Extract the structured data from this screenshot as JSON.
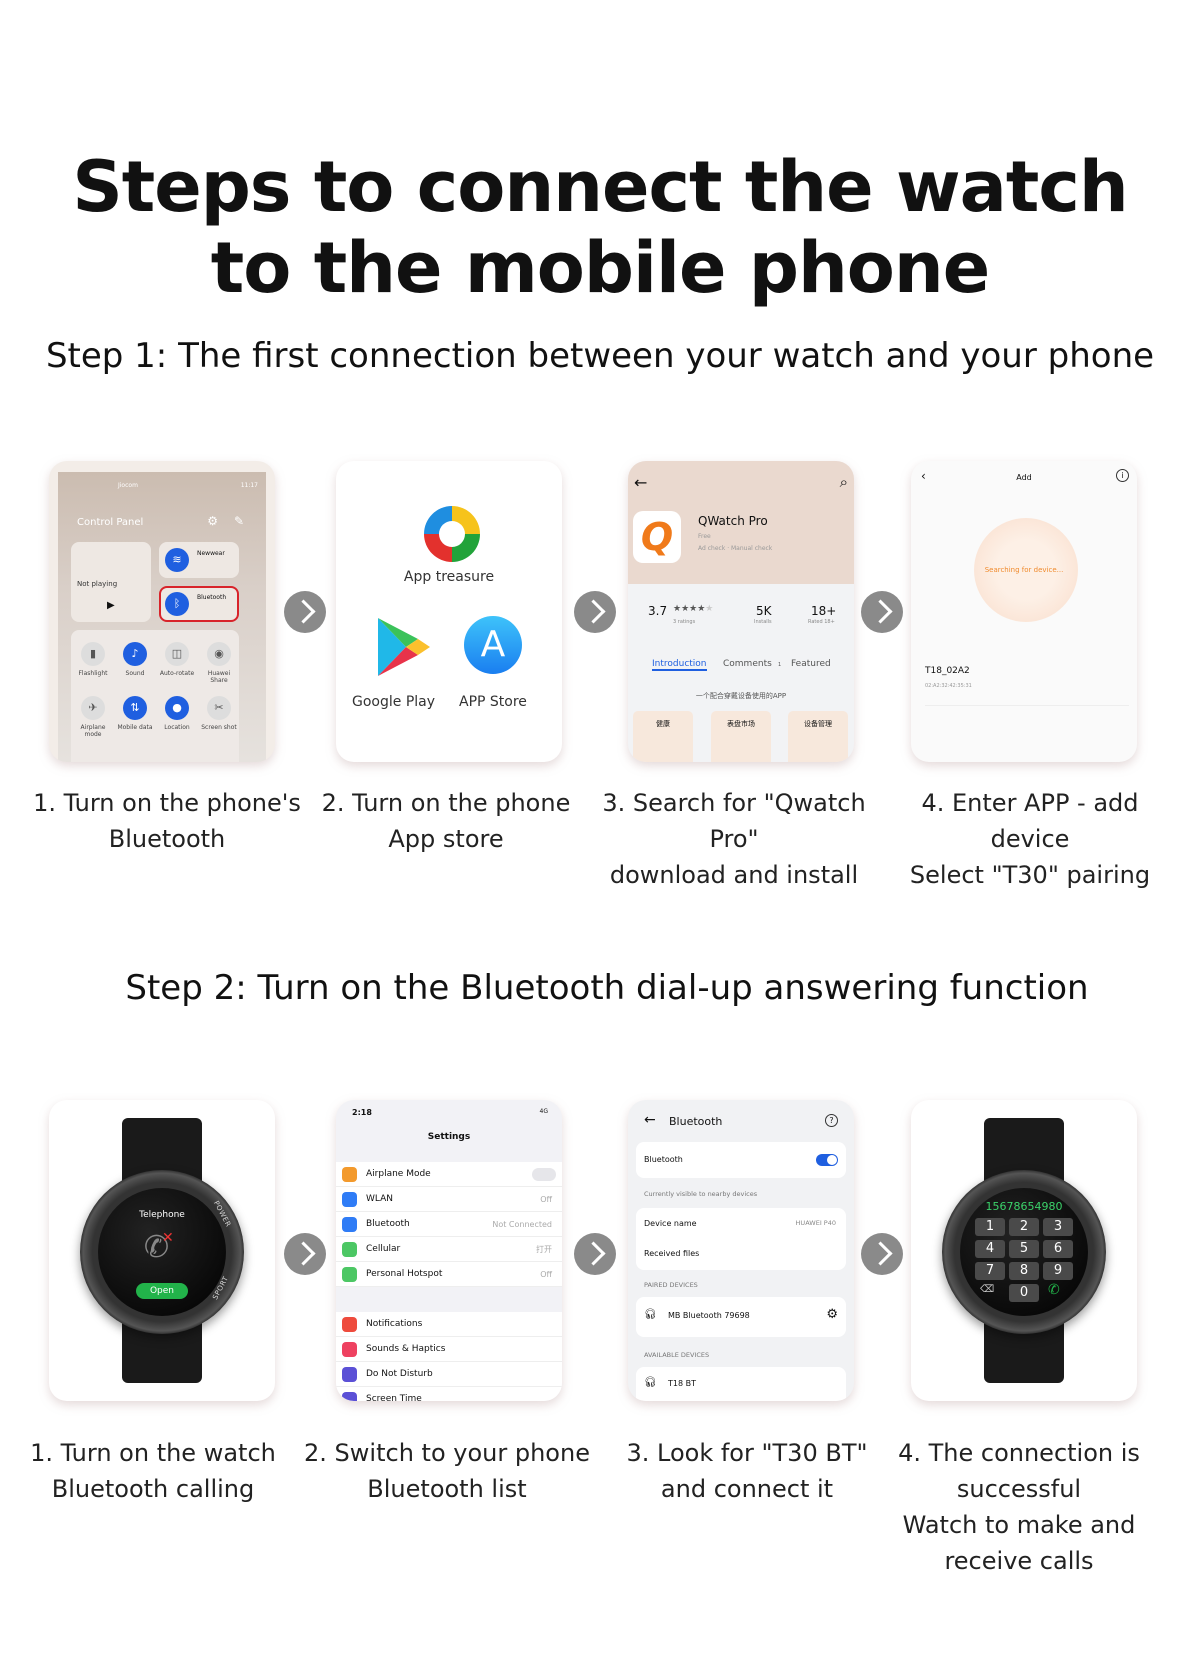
{
  "title": {
    "line1": "Steps to connect the watch",
    "line2": "to the mobile phone"
  },
  "step1": {
    "heading": "Step 1: The first connection between your watch and your phone",
    "captions": [
      [
        "1. Turn on the phone's",
        "Bluetooth"
      ],
      [
        "2. Turn on the phone",
        "App store"
      ],
      [
        "3. Search for \"Qwatch Pro\"",
        "download and install"
      ],
      [
        "4. Enter APP - add device",
        "Select \"T30\" pairing"
      ]
    ],
    "control_panel": {
      "carrier": "Jiocom",
      "time": "11:17",
      "title": "Control Panel",
      "media": "Not playing",
      "wifi": "Newwear",
      "bluetooth": "Bluetooth",
      "tiles": [
        "Flashlight",
        "Sound",
        "Auto-rotate",
        "Huawei Share",
        "Airplane mode",
        "Mobile data",
        "Location",
        "Screen shot"
      ]
    },
    "stores": {
      "app_treasure": "App treasure",
      "google_play": "Google Play",
      "app_store": "APP Store"
    },
    "app_page": {
      "name": "QWatch Pro",
      "price": "Free",
      "checks": "Ad check · Manual check",
      "rating": "3.7",
      "rating_count": "3 ratings",
      "installs": "5K",
      "installs_label": "Installs",
      "age": "18+",
      "age_label": "Rated 18+",
      "tabs": [
        "Introduction",
        "Comments",
        "Featured"
      ],
      "comments_count": "1",
      "slogan": "一个配合穿戴设备使用的APP",
      "features": [
        "健康",
        "表盘市场",
        "设备管理"
      ]
    },
    "add_page": {
      "title": "Add",
      "searching": "Searching for device...",
      "device": "T18_02A2",
      "mac": "02:A2:32:42:35:31"
    }
  },
  "step2": {
    "heading": "Step 2: Turn on the Bluetooth dial-up answering function",
    "captions": [
      [
        "1. Turn on the watch",
        "Bluetooth calling"
      ],
      [
        "2. Switch to your phone",
        "Bluetooth list"
      ],
      [
        "3. Look for \"T30 BT\"",
        "and connect it"
      ],
      [
        "4. The connection is",
        "successful",
        "Watch to make and",
        "receive calls"
      ]
    ],
    "watch1": {
      "label": "Telephone",
      "button": "Open",
      "side_top": "POWER",
      "side_bottom": "SPORT"
    },
    "settings": {
      "time": "2:18",
      "network": "4G",
      "title": "Settings",
      "rows": [
        {
          "label": "Airplane Mode",
          "value": "",
          "color": "#f39a2d"
        },
        {
          "label": "WLAN",
          "value": "Off",
          "color": "#2f7cf6"
        },
        {
          "label": "Bluetooth",
          "value": "Not Connected",
          "color": "#2f7cf6"
        },
        {
          "label": "Cellular",
          "value": "打开",
          "color": "#4cc764"
        },
        {
          "label": "Personal Hotspot",
          "value": "Off",
          "color": "#4cc764"
        }
      ],
      "rows2": [
        {
          "label": "Notifications",
          "color": "#ee4b3d"
        },
        {
          "label": "Sounds & Haptics",
          "color": "#ee4160"
        },
        {
          "label": "Do Not Disturb",
          "color": "#5b50d6"
        },
        {
          "label": "Screen Time",
          "color": "#5b50d6"
        }
      ]
    },
    "bluetooth": {
      "title": "Bluetooth",
      "toggle_label": "Bluetooth",
      "visible": "Currently visible to nearby devices",
      "device_name_label": "Device name",
      "device_name": "HUAWEI P40",
      "received": "Received files",
      "paired_header": "PAIRED DEVICES",
      "paired": "MB Bluetooth 79698",
      "available_header": "AVAILABLE DEVICES",
      "available": "T18 BT"
    },
    "watch2": {
      "number": "15678654980",
      "keys": [
        "1",
        "2",
        "3",
        "4",
        "5",
        "6",
        "7",
        "8",
        "9",
        "0"
      ]
    }
  },
  "colors": {
    "accent": "#1f5fe0",
    "arrow": "#8a8a8a",
    "green": "#22b34a",
    "orange": "#f08a2c"
  }
}
